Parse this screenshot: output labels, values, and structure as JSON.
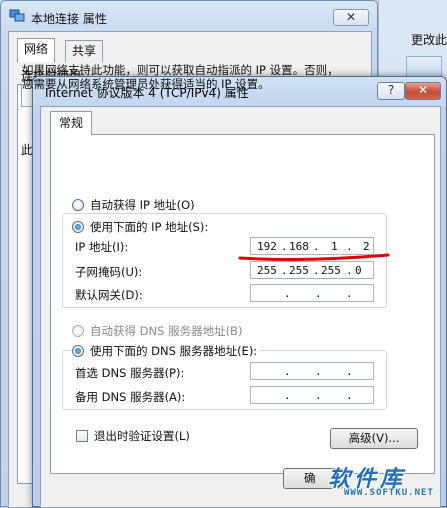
{
  "background_window": {
    "title": "本地连接 属性",
    "close_glyph": "✕",
    "tabs": [
      "网络",
      "共享"
    ],
    "connect_label": "连接时使用:",
    "side_letter": "此"
  },
  "right_strip": {
    "edit_label": "更改此"
  },
  "dialog": {
    "title": "Internet 协议版本 4 (TCP/IPv4) 属性",
    "help_glyph": "?",
    "close_glyph": "✕",
    "tab_general": "常规",
    "description_line1": "如果网络支持此功能，则可以获取自动指派的 IP 设置。否则，",
    "description_line2": "您需要从网络系统管理员处获得适当的 IP 设置。",
    "ip_auto_label": "自动获得 IP 地址(O)",
    "ip_manual_label": "使用下面的 IP 地址(S):",
    "ip_address_label": "IP 地址(I):",
    "ip_address": [
      "192",
      "168",
      "1",
      "2"
    ],
    "subnet_label": "子网掩码(U):",
    "subnet_mask": [
      "255",
      "255",
      "255",
      "0"
    ],
    "gateway_label": "默认网关(D):",
    "dns_auto_label": "自动获得 DNS 服务器地址(B)",
    "dns_manual_label": "使用下面的 DNS 服务器地址(E):",
    "dns_preferred_label": "首选 DNS 服务器(P):",
    "dns_alternate_label": "备用 DNS 服务器(A):",
    "validate_label": "退出时验证设置(L)",
    "advanced_button": "高级(V)...",
    "ok_button": "确"
  },
  "watermark": {
    "text": "软件库",
    "url": "WWW.SOFTKU.NET"
  },
  "colors": {
    "annotation_red": "#e00000",
    "watermark_blue": "#1e6fc0"
  }
}
